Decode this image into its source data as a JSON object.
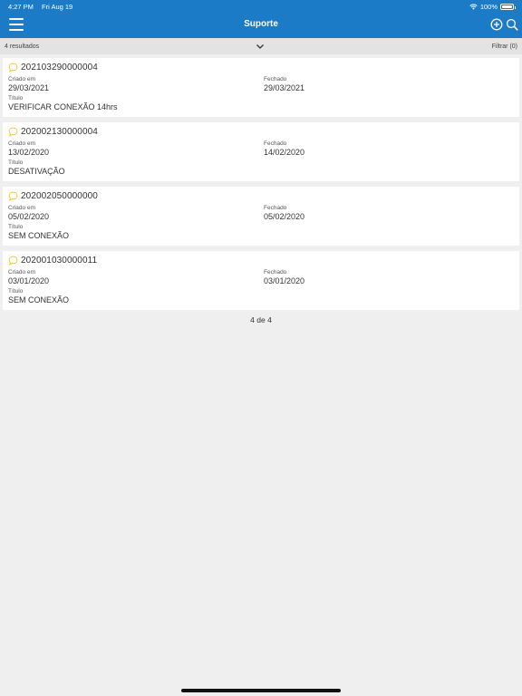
{
  "status_bar": {
    "time": "4:27 PM",
    "date": "Fri Aug 19",
    "battery": "100%",
    "battery_level": 1.0
  },
  "header": {
    "title": "Suporte"
  },
  "results_bar": {
    "count_label": "4 resultados",
    "filter_label": "Filtrar (0)"
  },
  "labels": {
    "created": "Criado em",
    "closed": "Fechado",
    "title": "Título"
  },
  "tickets": [
    {
      "id": "202103290000004",
      "created": "29/03/2021",
      "closed": "29/03/2021",
      "title": "VERIFICAR CONEXÃO 14hrs"
    },
    {
      "id": "202002130000004",
      "created": "13/02/2020",
      "closed": "14/02/2020",
      "title": "DESATIVAÇÃO"
    },
    {
      "id": "202002050000000",
      "created": "05/02/2020",
      "closed": "05/02/2020",
      "title": "SEM CONEXÃO"
    },
    {
      "id": "202001030000011",
      "created": "03/01/2020",
      "closed": "03/01/2020",
      "title": "SEM CONEXÃO"
    }
  ],
  "pagination": {
    "label": "4 de 4"
  },
  "colors": {
    "header": "#1b7bc6",
    "background": "#efefef",
    "accent": "#f0c419"
  },
  "icons": {
    "menu": "hamburger-icon",
    "add": "plus-circle-icon",
    "search": "search-icon",
    "expand": "chevron-down-icon",
    "ticket": "chat-bubble-icon",
    "wifi": "wifi-icon",
    "battery": "battery-icon"
  }
}
